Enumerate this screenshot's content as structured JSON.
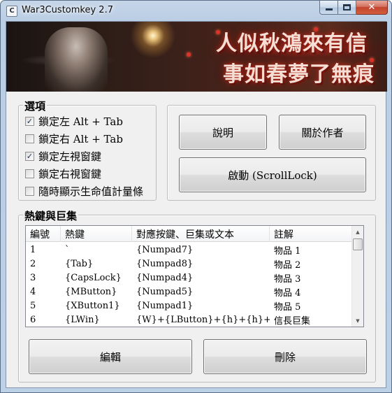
{
  "window": {
    "title": "War3Customkey 2.7",
    "icon_glyph": "C",
    "minimize_icon": "minimize-icon",
    "maximize_icon": "maximize-icon",
    "close_glyph": "✕"
  },
  "banner": {
    "line1": "人似秋鴻來有信",
    "line2": "事如春夢了無痕"
  },
  "options": {
    "title": "選項",
    "items": [
      {
        "label": "鎖定左 Alt + Tab",
        "checked": true,
        "mark": "✓"
      },
      {
        "label": "鎖定右 Alt + Tab",
        "checked": false,
        "mark": ""
      },
      {
        "label": "鎖定左視窗鍵",
        "checked": true,
        "mark": "✓"
      },
      {
        "label": "鎖定右視窗鍵",
        "checked": false,
        "mark": ""
      },
      {
        "label": "隨時顯示生命值計量條",
        "checked": false,
        "mark": ""
      }
    ]
  },
  "actions": {
    "help_label": "說明",
    "about_label": "關於作者",
    "start_label": "啟動 (ScrollLock)"
  },
  "hotkeys": {
    "title": "熱鍵與巨集",
    "columns": [
      "編號",
      "熱鍵",
      "對應按鍵、巨集或文本",
      "註解"
    ],
    "rows": [
      [
        "1",
        "`",
        "{Numpad7}",
        "物品 1"
      ],
      [
        "2",
        "{Tab}",
        "{Numpad8}",
        "物品 2"
      ],
      [
        "3",
        "{CapsLock}",
        "{Numpad4}",
        "物品 3"
      ],
      [
        "4",
        "{MButton}",
        "{Numpad5}",
        "物品 4"
      ],
      [
        "5",
        "{XButton1}",
        "{Numpad1}",
        "物品 5"
      ],
      [
        "6",
        "{LWin}",
        "{W}+{LButton}+{h}+{h}+{h...",
        "信長巨集"
      ]
    ],
    "scroll_up": "▲",
    "scroll_down": "▼"
  },
  "bottom": {
    "edit_label": "編輯",
    "delete_label": "刪除"
  }
}
